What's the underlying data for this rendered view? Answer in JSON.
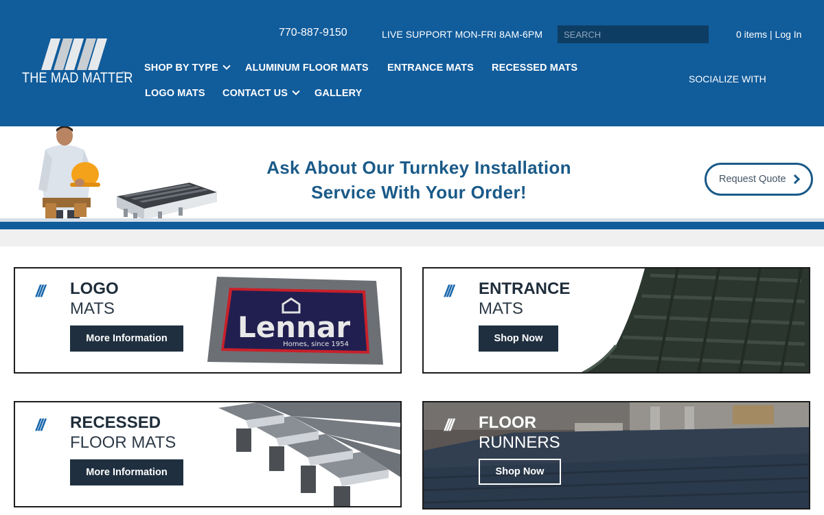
{
  "header": {
    "logo_text": "THE MAD MATTER",
    "logo_tm": "™",
    "phone": "770-887-9150",
    "support": "LIVE SUPPORT MON-FRI 8AM-6PM",
    "search_placeholder": "SEARCH",
    "account_items": "0 items",
    "account_sep": " | ",
    "account_login": "Log In",
    "socialize": "SOCIALIZE WITH",
    "nav": {
      "shop_by_type": "SHOP BY TYPE",
      "aluminum": "ALUMINUM FLOOR MATS",
      "entrance": "ENTRANCE MATS",
      "recessed": "RECESSED MATS",
      "logo_mats": "LOGO MATS",
      "contact": "CONTACT US",
      "gallery": "GALLERY"
    },
    "colors": {
      "brand_blue": "#115c9b",
      "search_bg": "#0e3d63"
    }
  },
  "banner": {
    "line1": "Ask About Our  Turnkey Installation",
    "line2": "Service With Your Order!",
    "quote_button": "Request Quote",
    "mat_logo_text": "Lennar",
    "mat_logo_sub": "Homes, since 1954"
  },
  "cards": [
    {
      "slash": "///",
      "title1": "LOGO",
      "title2": "MATS",
      "button": "More Information",
      "image": "logo-mat-image"
    },
    {
      "slash": "///",
      "title1": "ENTRANCE",
      "title2": "MATS",
      "button": "Shop Now",
      "image": "entrance-mat-image"
    },
    {
      "slash": "///",
      "title1": "RECESSED",
      "title2": "FLOOR MATS",
      "button": "More Information",
      "image": "recessed-mat-image"
    },
    {
      "slash": "///",
      "title1": "FLOOR",
      "title2": "RUNNERS",
      "button": "Shop Now",
      "image": "floor-runner-image"
    }
  ]
}
